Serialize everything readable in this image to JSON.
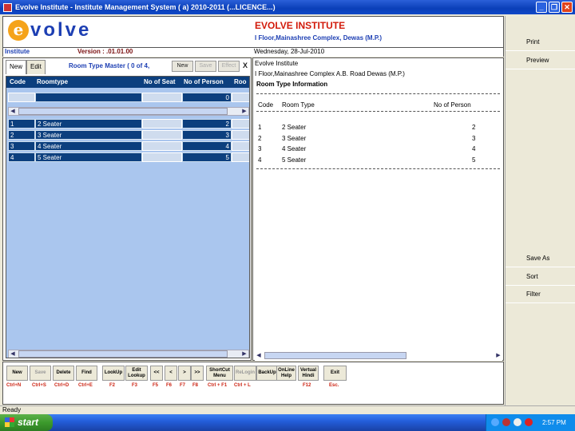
{
  "window": {
    "title": "Evolve Institute - Institute Management System ( a) 2010-2011 (...LICENCE...)"
  },
  "header": {
    "logo_letter": "e",
    "logo_text": "volve",
    "institute_name": "EVOLVE INSTITUTE",
    "institute_address": "I Floor,Mainashree Complex, Dewas (M.P.)"
  },
  "infobar": {
    "module": "Institute",
    "version": "Version : .01.01.00",
    "date": "Wednesday, 28-Jul-2010"
  },
  "form": {
    "tabs": [
      "New",
      "Edit"
    ],
    "title": "Room Type Master  ( 0 of 4,",
    "buttons": {
      "new": "New",
      "save": "Save",
      "effect": "Effect",
      "close": "X"
    }
  },
  "grid": {
    "columns": [
      "Code",
      "Roomtype",
      "No of Seat",
      "No of Person",
      "Roo"
    ],
    "filter_row": {
      "person": "0"
    },
    "rows": [
      {
        "code": "1",
        "roomtype": "2 Seater",
        "seat": "",
        "person": "2"
      },
      {
        "code": "2",
        "roomtype": "3 Seater",
        "seat": "",
        "person": "3"
      },
      {
        "code": "3",
        "roomtype": "4 Seater",
        "seat": "",
        "person": "4"
      },
      {
        "code": "4",
        "roomtype": "5 Seater",
        "seat": "",
        "person": "5"
      }
    ]
  },
  "report": {
    "name": "Evolve Institute",
    "address": "I Floor,Mainashree Complex A.B. Road Dewas (M.P.)",
    "heading": "Room Type Information",
    "columns": [
      "Code",
      "Room Type",
      "No of Person"
    ],
    "rows": [
      {
        "code": "1",
        "type": "2 Seater",
        "person": "2"
      },
      {
        "code": "2",
        "type": "3 Seater",
        "person": "3"
      },
      {
        "code": "3",
        "type": "4 Seater",
        "person": "4"
      },
      {
        "code": "4",
        "type": "5 Seater",
        "person": "5"
      }
    ]
  },
  "sidebar": {
    "print": "Print",
    "preview": "Preview",
    "save_as": "Save As",
    "sort": "Sort",
    "filter": "Filter"
  },
  "bottom": {
    "buttons": [
      "New",
      "Save",
      "Delete",
      "Find",
      "LookUp",
      "Edit Lookup",
      "<<",
      "<",
      ">",
      ">>",
      "ShortCut Menu",
      "ReLogin",
      "BackUp",
      "OnLine Help",
      "Vertual Hindi",
      "Exit"
    ],
    "keys": [
      "Ctrl+N",
      "Ctrl+S",
      "Ctrl+D",
      "Ctrl+E",
      "F2",
      "F3",
      "F5",
      "F6",
      "F7",
      "F8",
      "Ctrl + F1",
      "Ctrl + L",
      "F12",
      "Esc."
    ]
  },
  "status": {
    "text": "Ready"
  },
  "taskbar": {
    "start": "start",
    "time": "2:57 PM"
  }
}
